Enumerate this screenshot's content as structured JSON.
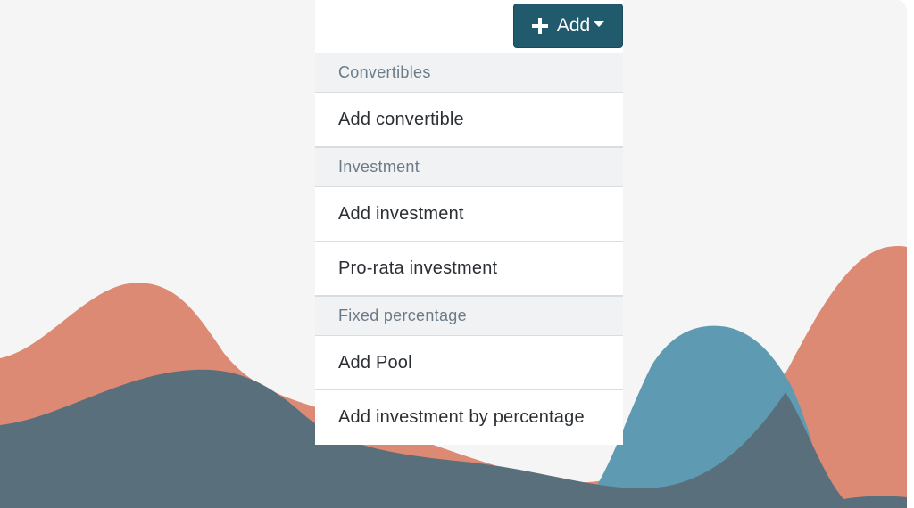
{
  "add_button": {
    "label": "Add",
    "plus_icon": "plus-icon",
    "caret_icon": "caret-down-icon",
    "color": "#215a6d"
  },
  "menu": {
    "sections": [
      {
        "header": "Convertibles",
        "items": [
          "Add convertible"
        ]
      },
      {
        "header": "Investment",
        "items": [
          "Add investment",
          "Pro-rata investment"
        ]
      },
      {
        "header": "Fixed percentage",
        "items": [
          "Add Pool",
          "Add investment by percentage"
        ]
      }
    ]
  },
  "colors": {
    "background": "#f5f5f5",
    "wave_salmon": "#dc8a74",
    "wave_slate": "#5a6f7c",
    "wave_blue": "#5e9bb2"
  }
}
